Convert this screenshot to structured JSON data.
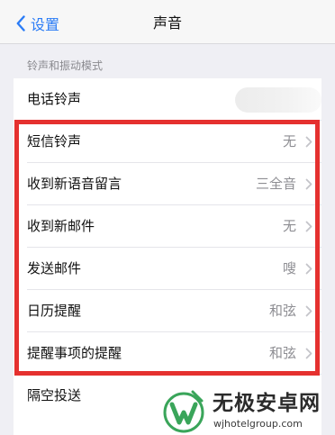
{
  "nav": {
    "back_label": "设置",
    "title": "声音"
  },
  "section": {
    "header": "铃声和振动模式"
  },
  "rows": [
    {
      "label": "电话铃声",
      "value": ""
    },
    {
      "label": "短信铃声",
      "value": "无"
    },
    {
      "label": "收到新语音留言",
      "value": "三全音"
    },
    {
      "label": "收到新邮件",
      "value": "无"
    },
    {
      "label": "发送邮件",
      "value": "嗖"
    },
    {
      "label": "日历提醒",
      "value": "和弦"
    },
    {
      "label": "提醒事项的提醒",
      "value": "和弦"
    },
    {
      "label": "隔空投送",
      "value": ""
    }
  ],
  "watermark": {
    "title": "无极安卓网",
    "url": "wjhotelgroup.com"
  },
  "colors": {
    "accent": "#2b7cf6",
    "highlight": "#e5312f",
    "logo_green": "#3aa55a"
  }
}
